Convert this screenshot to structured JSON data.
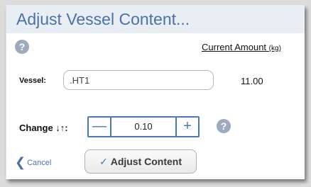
{
  "dialog": {
    "title": "Adjust Vessel Content...",
    "current_amount_label": "Current Amount",
    "current_amount_unit": "(kg)",
    "help_glyph": "?",
    "vessel_label": "Vessel:",
    "vessel_value": ".HT1",
    "current_amount_value": "11.00",
    "change_label": "Change ↓↑:",
    "change_value": "0.10",
    "minus_glyph": "—",
    "plus_glyph": "+",
    "cancel_label": "Cancel",
    "cancel_icon": "chevron-left-icon",
    "adjust_label": "Adjust Content",
    "adjust_icon": "check-icon"
  },
  "colors": {
    "accent": "#4a78b9",
    "title_text": "#4a72a8",
    "title_bar": "#e9edf4",
    "help_icon": "#9dabbd"
  }
}
